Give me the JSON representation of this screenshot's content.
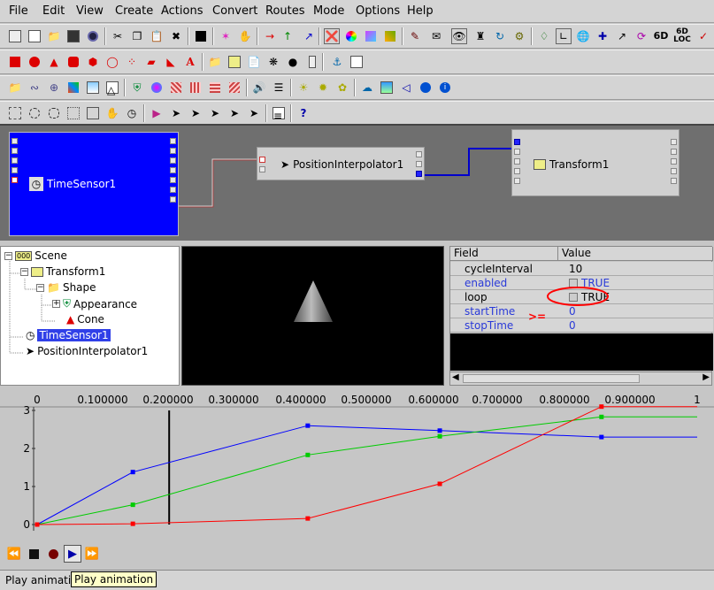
{
  "menu": [
    "File",
    "Edit",
    "View",
    "Create",
    "Actions",
    "Convert",
    "Routes",
    "Mode",
    "Options",
    "Help"
  ],
  "toolbar3_text": [
    "6D",
    "6D",
    "LOC",
    "?"
  ],
  "route_nodes": {
    "time_sensor": "TimeSensor1",
    "interpolator": "PositionInterpolator1",
    "transform": "Transform1"
  },
  "scene_tree": {
    "scene": "Scene",
    "transform": "Transform1",
    "shape": "Shape",
    "appearance": "Appearance",
    "cone": "Cone",
    "time_sensor": "TimeSensor1",
    "interpolator": "PositionInterpolator1"
  },
  "field_table": {
    "header_field": "Field",
    "header_value": "Value",
    "rows": [
      {
        "field": "cycleInterval",
        "value": "10"
      },
      {
        "field": "enabled",
        "value": "TRUE"
      },
      {
        "field": "loop",
        "value": "TRUE"
      },
      {
        "field": "startTime",
        "value": "0"
      },
      {
        "field": "stopTime",
        "value": "0"
      }
    ],
    "annotation": ">="
  },
  "chart_data": {
    "type": "line",
    "x_tick_labels": [
      "0",
      "0.100000",
      "0.200000",
      "0.300000",
      "0.400000",
      "0.500000",
      "0.600000",
      "0.700000",
      "0.800000",
      "0.900000",
      "1"
    ],
    "y_tick_labels": [
      "3",
      "2",
      "1",
      "0"
    ],
    "xlim": [
      0,
      1
    ],
    "ylim": [
      0,
      3
    ],
    "current_time": 0.2,
    "series": [
      {
        "color": "#0000ff",
        "x": [
          0,
          0.145,
          0.41,
          0.61,
          0.855,
          1.0
        ],
        "y": [
          0,
          1.38,
          2.6,
          2.47,
          2.3,
          2.3
        ]
      },
      {
        "color": "#00cc00",
        "x": [
          0,
          0.145,
          0.41,
          0.61,
          0.855,
          1.0
        ],
        "y": [
          0,
          0.52,
          1.83,
          2.32,
          2.83,
          2.83
        ]
      },
      {
        "color": "#ff0000",
        "x": [
          0,
          0.145,
          0.41,
          0.61,
          0.855,
          1.0
        ],
        "y": [
          0,
          0.02,
          0.16,
          1.07,
          3.1,
          3.1
        ]
      }
    ]
  },
  "status": {
    "text": "Play animation"
  },
  "tooltip": "Play animation",
  "colors": {
    "selection": "#3040e8",
    "node_selected": "#0000ff",
    "route_blue": "#0000cc",
    "annotation": "#ff0000"
  }
}
